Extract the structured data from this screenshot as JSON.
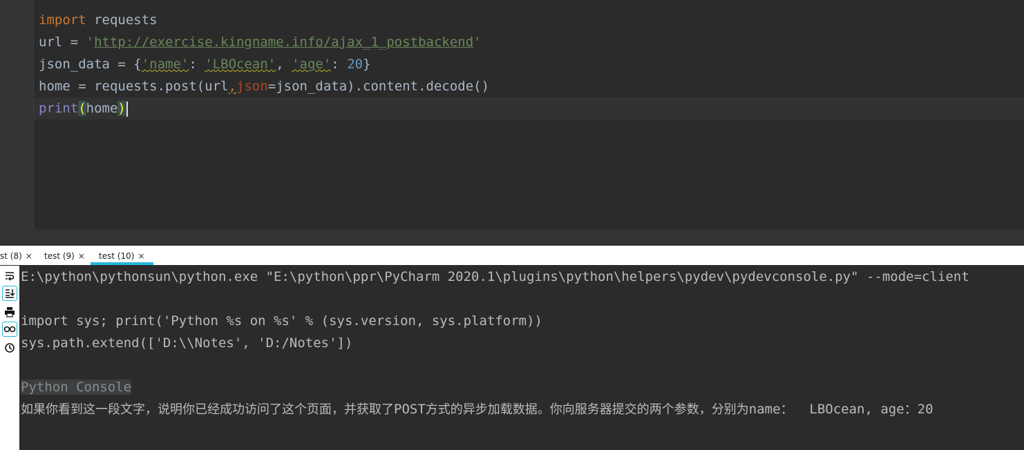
{
  "editor": {
    "line1": {
      "kw": "import",
      "rest": " requests"
    },
    "line2": {
      "a": "url = ",
      "q1": "'",
      "url": "http://exercise.kingname.info/ajax_1_postbackend",
      "q2": "'"
    },
    "line3": {
      "a": "json_data = {",
      "k1": "'name'",
      "c1": ": ",
      "v1": "'LBOcean'",
      "c2": ", ",
      "k2": "'age'",
      "c3": ": ",
      "v2": "20",
      "end": "}"
    },
    "line4": {
      "a": "home = requests.post(url",
      "comma": ",",
      "param": "json",
      "b": "=json_data).content.decode()"
    },
    "line5": {
      "fn": "print",
      "open": "(",
      "arg": "home",
      "close": ")"
    }
  },
  "tabs": [
    {
      "label": "st (8)",
      "close": "×"
    },
    {
      "label": "test (9)",
      "close": "×"
    },
    {
      "label": "test (10)",
      "close": "×"
    }
  ],
  "toolbar": {
    "icons": [
      "soft-wrap-icon",
      "scroll-to-end-icon",
      "print-icon",
      "show-variables-icon",
      "history-icon"
    ]
  },
  "console": {
    "line1": "E:\\python\\pythonsun\\python.exe \"E:\\python\\ppr\\PyCharm 2020.1\\plugins\\python\\helpers\\pydev\\pydevconsole.py\" --mode=client",
    "line2": "import sys; print('Python %s on %s' % (sys.version, sys.platform))",
    "line3": "sys.path.extend(['D:\\\\Notes', 'D:/Notes'])",
    "line4": "Python Console",
    "line5_cjk": "如果你看到这一段文字，说明你已经成功访问了这个页面，并获取了",
    "line5_a": "POST",
    "line5_cjk2": "方式的异步加载数据。你向服务器提交的两个参数，分别为",
    "line5_b": "name：  LBOcean, age：20"
  }
}
